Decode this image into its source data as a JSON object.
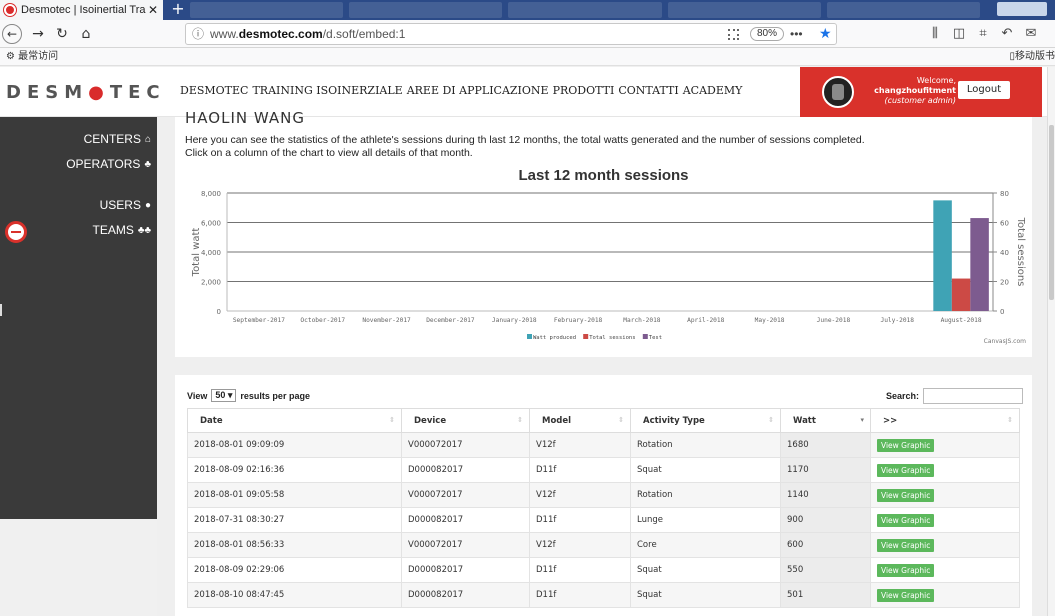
{
  "browser": {
    "tab_title": "Desmotec | Isoinertial Trainin",
    "url_prefix": "www.",
    "url_host": "desmotec.com",
    "url_path": "/d.soft/embed:1",
    "zoom": "80%",
    "bookmark_left": "最常访问",
    "bookmark_right": "移动版书"
  },
  "header": {
    "menu": [
      "DESMOTEC",
      "TRAINING ISOINERZIALE",
      "AREE DI APPLICAZIONE",
      "PRODOTTI",
      "CONTATTI",
      "ACADEMY"
    ],
    "welcome": "Welcome,",
    "username": "changzhoufitment",
    "role": "(customer admin)",
    "logout": "Logout"
  },
  "sidebar": {
    "items": [
      {
        "label": "CENTERS",
        "icon": "home-icon"
      },
      {
        "label": "OPERATORS",
        "icon": "operator-icon"
      },
      {
        "label": "USERS",
        "icon": "user-icon"
      },
      {
        "label": "TEAMS",
        "icon": "group-icon"
      }
    ]
  },
  "stats": {
    "athlete_name": "HAOLIN WANG",
    "description_line1": "Here you can see the statistics of the athlete's sessions during th last 12 months, the total watts generated and the number of sessions completed.",
    "description_line2": "Click on a column of the chart to view all details of that month.",
    "credit": "CanvasJS.com"
  },
  "chart_data": {
    "type": "bar",
    "title": "Last 12 month sessions",
    "ylabel": "Total watt",
    "y2label": "Total sessions",
    "ylim": [
      0,
      8000
    ],
    "y2lim": [
      0,
      80
    ],
    "yticks": [
      "0",
      "2,000",
      "4,000",
      "6,000",
      "8,000"
    ],
    "y2ticks": [
      "0",
      "20",
      "40",
      "60",
      "80"
    ],
    "categories": [
      "September-2017",
      "October-2017",
      "November-2017",
      "December-2017",
      "January-2018",
      "February-2018",
      "March-2018",
      "April-2018",
      "May-2018",
      "June-2018",
      "July-2018",
      "August-2018"
    ],
    "series": [
      {
        "name": "Watt produced",
        "axis": "left",
        "color": "#3fa3b5",
        "values": [
          0,
          0,
          0,
          0,
          0,
          0,
          0,
          0,
          0,
          0,
          0,
          7500
        ]
      },
      {
        "name": "Total sessions",
        "axis": "right",
        "color": "#cc4a45",
        "values": [
          0,
          0,
          0,
          0,
          0,
          0,
          0,
          0,
          0,
          0,
          0,
          22
        ]
      },
      {
        "name": "Test",
        "axis": "right",
        "color": "#7d5b8f",
        "values": [
          0,
          0,
          0,
          0,
          0,
          0,
          0,
          0,
          0,
          0,
          0,
          63
        ]
      }
    ],
    "legend": "bottom-center",
    "grid": true
  },
  "table": {
    "view_label": "View",
    "page_size": "50",
    "page_suffix": "results per page",
    "search_label": "Search:",
    "headers": [
      "Date",
      "Device",
      "Model",
      "Activity Type",
      "Watt",
      ">>"
    ],
    "button_label": "View Graphic",
    "rows": [
      [
        "2018-08-01 09:09:09",
        "V000072017",
        "V12f",
        "Rotation",
        "1680"
      ],
      [
        "2018-08-09 02:16:36",
        "D000082017",
        "D11f",
        "Squat",
        "1170"
      ],
      [
        "2018-08-01 09:05:58",
        "V000072017",
        "V12f",
        "Rotation",
        "1140"
      ],
      [
        "2018-07-31 08:30:27",
        "D000082017",
        "D11f",
        "Lunge",
        "900"
      ],
      [
        "2018-08-01 08:56:33",
        "V000072017",
        "V12f",
        "Core",
        "600"
      ],
      [
        "2018-08-09 02:29:06",
        "D000082017",
        "D11f",
        "Squat",
        "550"
      ],
      [
        "2018-08-10 08:47:45",
        "D000082017",
        "D11f",
        "Squat",
        "501"
      ]
    ]
  }
}
